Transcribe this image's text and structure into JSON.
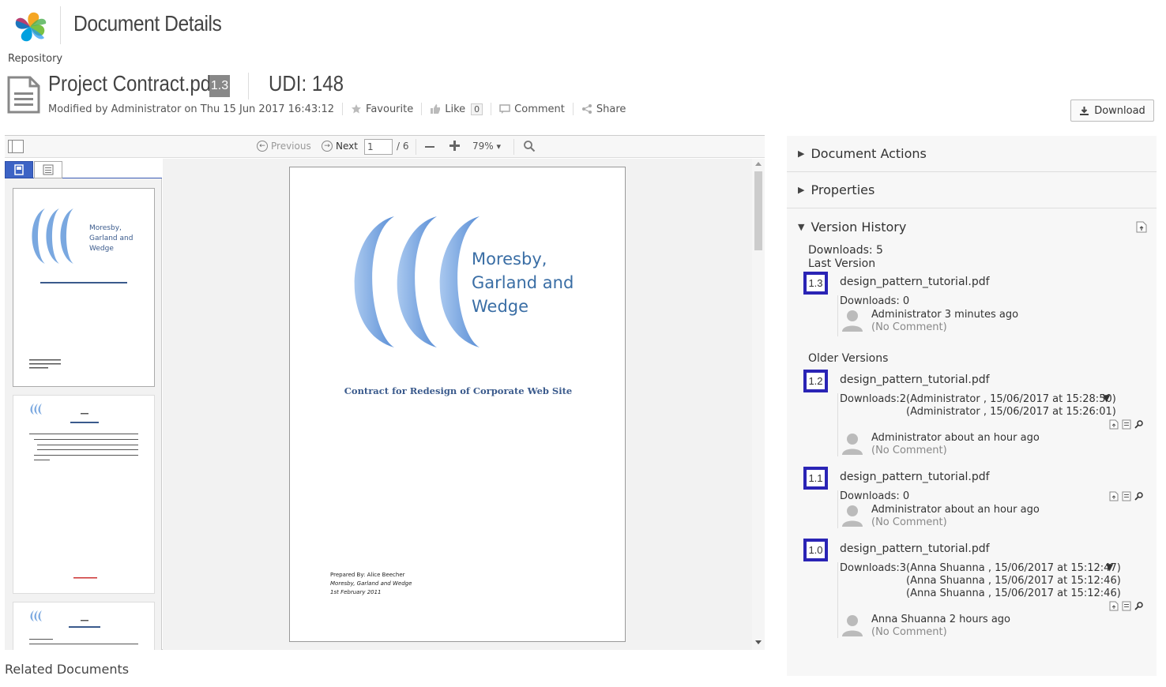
{
  "header": {
    "title": "Document Details",
    "breadcrumb": "Repository"
  },
  "document": {
    "name": "Project Contract.pdf",
    "version": "1.3",
    "udi": "UDI: 148",
    "modified": "Modified by Administrator on Thu 15 Jun 2017 16:43:12",
    "actions": {
      "favourite": "Favourite",
      "like": "Like",
      "like_count": "0",
      "comment": "Comment",
      "share": "Share"
    },
    "download_label": "Download"
  },
  "viewer": {
    "previous": "Previous",
    "next": "Next",
    "page_value": "1",
    "page_total": "/ 6",
    "zoom": "79%"
  },
  "page_content": {
    "company_line1": "Moresby,",
    "company_line2": "Garland and",
    "company_line3": "Wedge",
    "contract_title": "Contract for Redesign of Corporate Web Site",
    "prepared_by": "Prepared By: Alice Beecher",
    "prepared_company": "Moresby, Garland and Wedge",
    "prepared_date": "1st February 2011"
  },
  "related_documents": "Related Documents",
  "panel": {
    "document_actions": "Document Actions",
    "properties": "Properties",
    "version_history": "Version History",
    "downloads_total": "Downloads: 5",
    "last_version_label": "Last Version",
    "older_versions_label": "Older Versions",
    "versions": [
      {
        "label": "1.3",
        "file": "design_pattern_tutorial.pdf",
        "downloads": "Downloads: 0",
        "author": "Administrator 3 minutes ago",
        "comment": "(No Comment)"
      },
      {
        "label": "1.2",
        "file": "design_pattern_tutorial.pdf",
        "downloads": "Downloads:2",
        "log": [
          "(Administrator , 15/06/2017 at 15:28:50)",
          "(Administrator , 15/06/2017 at 15:26:01)"
        ],
        "author": "Administrator about an hour ago",
        "comment": "(No Comment)"
      },
      {
        "label": "1.1",
        "file": "design_pattern_tutorial.pdf",
        "downloads": "Downloads: 0",
        "author": "Administrator about an hour ago",
        "comment": "(No Comment)"
      },
      {
        "label": "1.0",
        "file": "design_pattern_tutorial.pdf",
        "downloads": "Downloads:3",
        "log": [
          "(Anna Shuanna , 15/06/2017 at 15:12:47)",
          "(Anna Shuanna , 15/06/2017 at 15:12:46)",
          "(Anna Shuanna , 15/06/2017 at 15:12:46)"
        ],
        "author": "Anna Shuanna 2 hours ago",
        "comment": "(No Comment)"
      }
    ]
  },
  "colors": {
    "version_badge_border": "#2a24b5",
    "thumb_tab_active": "#3c63c5",
    "logo_blue": "#5b8fd6",
    "contract_title": "#3a5a8c"
  }
}
